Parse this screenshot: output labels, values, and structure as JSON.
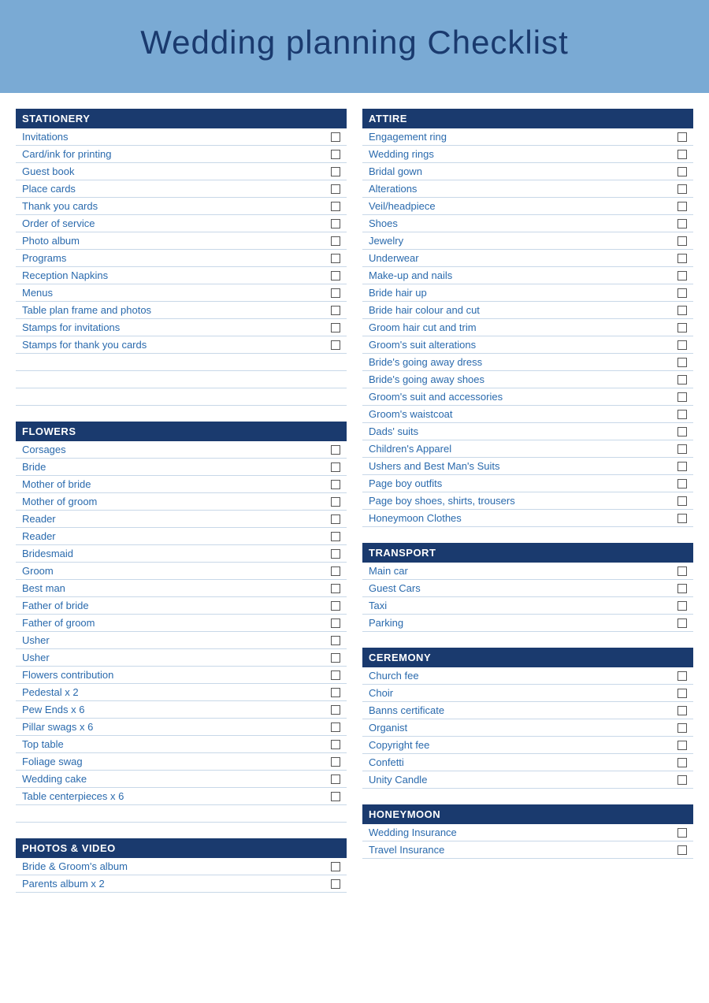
{
  "header": {
    "title": "Wedding planning Checklist"
  },
  "sections": {
    "stationery": {
      "label": "STATIONERY",
      "items": [
        "Invitations",
        "Card/ink for printing",
        "Guest book",
        "Place cards",
        "Thank you cards",
        "Order of service",
        "Photo album",
        "Programs",
        "Reception Napkins",
        "Menus",
        "Table plan frame and photos",
        "Stamps for invitations",
        "Stamps for thank you cards",
        "",
        "",
        ""
      ]
    },
    "attire": {
      "label": "ATTIRE",
      "items": [
        "Engagement ring",
        "Wedding rings",
        "Bridal gown",
        "Alterations",
        "Veil/headpiece",
        "Shoes",
        "Jewelry",
        "Underwear",
        "Make-up and nails",
        "Bride hair up",
        "Bride hair colour and cut",
        "Groom hair cut and trim",
        "Groom's suit alterations",
        "Bride's going away dress",
        "Bride's going away shoes",
        "Groom's suit and accessories",
        "Groom's waistcoat",
        "Dads' suits",
        "Children's Apparel",
        "Ushers and Best Man's Suits",
        "Page boy outfits",
        "Page boy shoes, shirts, trousers",
        "Honeymoon Clothes"
      ]
    },
    "flowers": {
      "label": "FLOWERS",
      "items": [
        "Corsages",
        "Bride",
        "Mother of bride",
        "Mother of groom",
        "Reader",
        "Reader",
        "Bridesmaid",
        "Groom",
        "Best man",
        "Father of bride",
        "Father of groom",
        "Usher",
        "Usher",
        "Flowers contribution",
        "Pedestal x 2",
        "Pew Ends x 6",
        "Pillar swags x 6",
        "Top table",
        "Foliage swag",
        "Wedding cake",
        "Table centerpieces x 6",
        ""
      ]
    },
    "transport": {
      "label": "TRANSPORT",
      "items": [
        "Main car",
        "Guest Cars",
        "Taxi",
        "Parking"
      ]
    },
    "ceremony": {
      "label": "CEREMONY",
      "items": [
        "Church fee",
        "Choir",
        "Banns certificate",
        "Organist",
        "Copyright fee",
        "Confetti",
        "Unity Candle"
      ]
    },
    "photos": {
      "label": "PHOTOS & VIDEO",
      "items": [
        "Bride & Groom's album",
        "Parents album x 2"
      ]
    },
    "honeymoon": {
      "label": "HONEYMOON",
      "items": [
        "Wedding Insurance",
        "Travel Insurance"
      ]
    }
  }
}
